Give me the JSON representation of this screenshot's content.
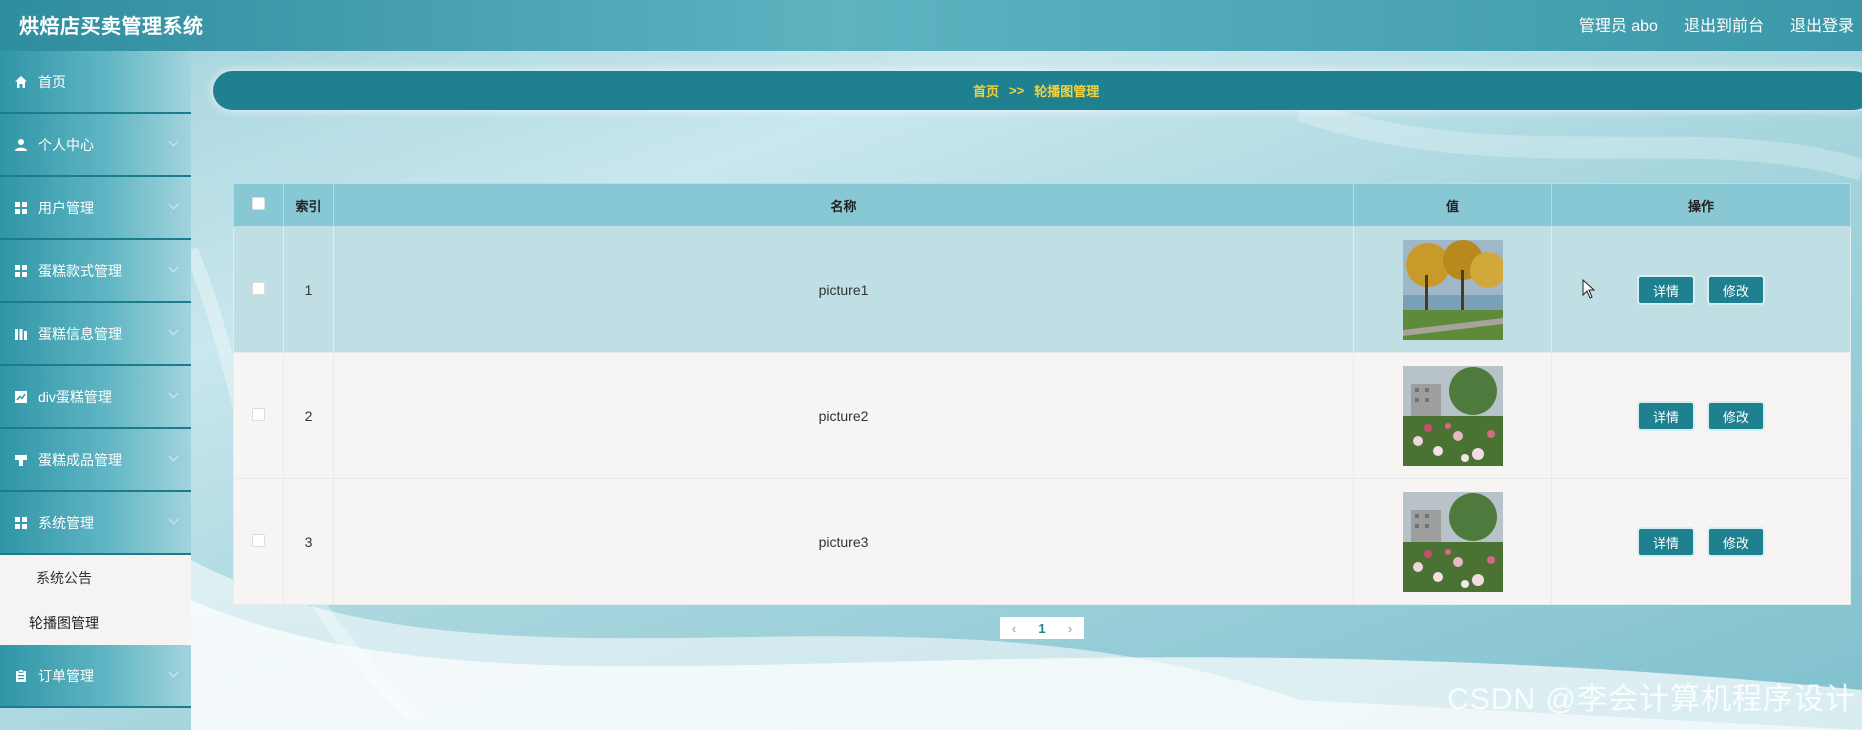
{
  "header": {
    "title": "烘焙店买卖管理系统",
    "user": "管理员 abo",
    "front_link": "退出到前台",
    "logout": "退出登录"
  },
  "sidebar": {
    "items": [
      {
        "label": "首页",
        "icon": "home-icon"
      },
      {
        "label": "个人中心",
        "icon": "user-icon"
      },
      {
        "label": "用户管理",
        "icon": "grid-icon"
      },
      {
        "label": "蛋糕款式管理",
        "icon": "grid-icon"
      },
      {
        "label": "蛋糕信息管理",
        "icon": "bars-icon"
      },
      {
        "label": "div蛋糕管理",
        "icon": "chart-icon"
      },
      {
        "label": "蛋糕成品管理",
        "icon": "flag-icon"
      },
      {
        "label": "系统管理",
        "icon": "grid-icon"
      }
    ],
    "sub_items": [
      "系统公告",
      "轮播图管理"
    ],
    "last_item": {
      "label": "订单管理",
      "icon": "clipboard-icon"
    }
  },
  "breadcrumb": {
    "home": "首页",
    "sep": ">>",
    "current": "轮播图管理"
  },
  "table": {
    "headers": [
      "索引",
      "名称",
      "值",
      "操作"
    ],
    "rows": [
      {
        "index": "1",
        "name": "picture1",
        "image": "autumn-trees-thumbnail"
      },
      {
        "index": "2",
        "name": "picture2",
        "image": "roses-garden-thumbnail"
      },
      {
        "index": "3",
        "name": "picture3",
        "image": "roses-garden-thumbnail"
      }
    ],
    "detail_label": "详情",
    "edit_label": "修改"
  },
  "pagination": {
    "prev": "‹",
    "current": "1",
    "next": "›"
  },
  "watermark": "CSDN @李会计算机程序设计",
  "colors": {
    "accent": "#1f8190",
    "breadcrumb_text": "#f3d23a",
    "header": "#3a98a8"
  }
}
